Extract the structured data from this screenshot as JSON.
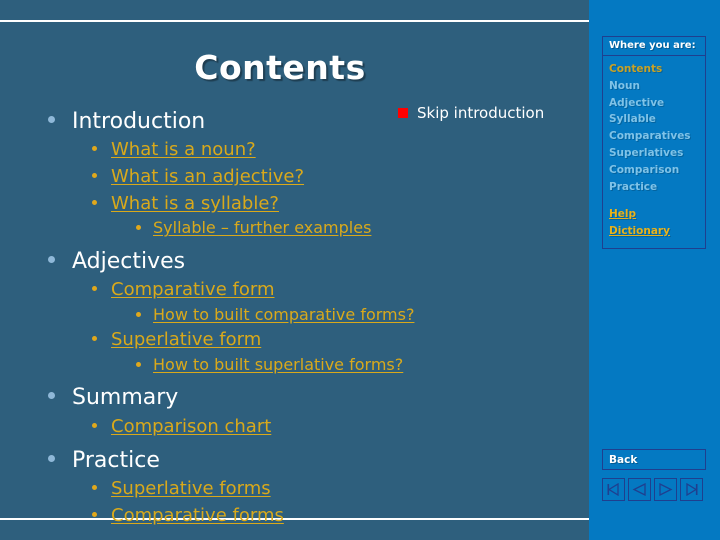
{
  "slide": {
    "title": "Contents",
    "skip": {
      "bullet_icon": "red-square-bullet",
      "label": "Skip introduction",
      "bullet_color": "#ff0000"
    },
    "outline": [
      {
        "level": 1,
        "text": "Introduction",
        "link": false
      },
      {
        "level": 2,
        "text": "What is a noun?",
        "link": true
      },
      {
        "level": 2,
        "text": "What is an adjective?",
        "link": true
      },
      {
        "level": 2,
        "text": "What is a syllable?",
        "link": true
      },
      {
        "level": 3,
        "text": "Syllable – further examples",
        "link": true
      },
      {
        "level": 1,
        "text": "Adjectives",
        "link": false
      },
      {
        "level": 2,
        "text": "Comparative form",
        "link": true
      },
      {
        "level": 3,
        "text": "How to built comparative forms?",
        "link": true
      },
      {
        "level": 2,
        "text": "Superlative form",
        "link": true
      },
      {
        "level": 3,
        "text": "How to built superlative forms?",
        "link": true
      },
      {
        "level": 1,
        "text": "Summary",
        "link": false
      },
      {
        "level": 2,
        "text": "Comparison chart",
        "link": true
      },
      {
        "level": 1,
        "text": "Practice",
        "link": false
      },
      {
        "level": 2,
        "text": "Superlative forms",
        "link": true
      },
      {
        "level": 2,
        "text": "Comparative forms",
        "link": true
      }
    ]
  },
  "sidebar": {
    "header": "Where you are:",
    "items": [
      {
        "label": "Contents",
        "state": "current"
      },
      {
        "label": "Noun",
        "state": "normal"
      },
      {
        "label": "Adjective",
        "state": "normal"
      },
      {
        "label": "Syllable",
        "state": "normal"
      },
      {
        "label": "Comparatives",
        "state": "normal"
      },
      {
        "label": "Superlatives",
        "state": "normal"
      },
      {
        "label": "Comparison",
        "state": "normal"
      },
      {
        "label": "Practice",
        "state": "normal"
      }
    ],
    "utility_links": [
      {
        "label": "Help"
      },
      {
        "label": "Dictionary"
      }
    ],
    "back_label": "Back",
    "nav_buttons": [
      {
        "icon": "first-page-icon"
      },
      {
        "icon": "previous-page-icon"
      },
      {
        "icon": "next-page-icon"
      },
      {
        "icon": "last-page-icon"
      }
    ]
  },
  "colors": {
    "slide_background": "#2e5f7d",
    "panel_background": "#0479c2",
    "link_gold": "#d9a91b",
    "sidebar_current": "#c8a225",
    "sidebar_normal": "#7fc3e8",
    "heading_white": "#ffffff",
    "panel_border": "#1f3f8f"
  }
}
